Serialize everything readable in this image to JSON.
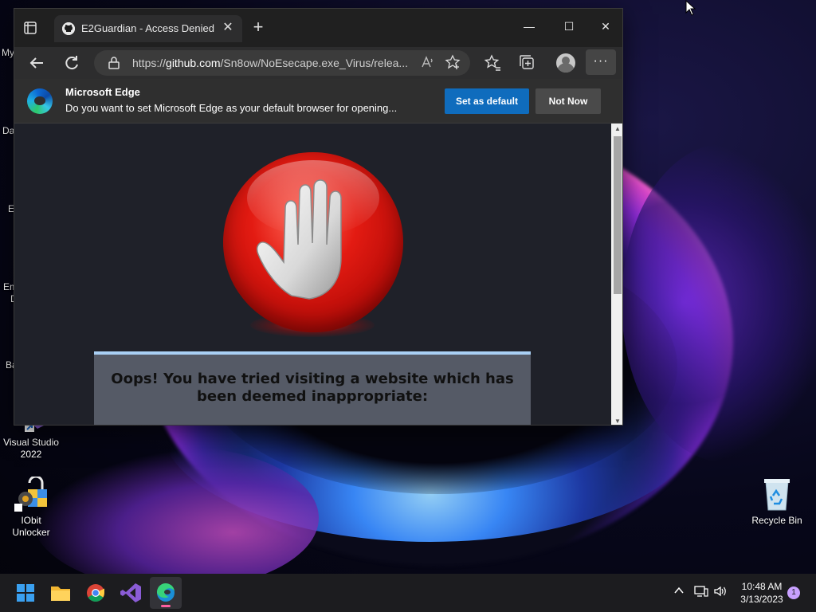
{
  "desktop": {
    "icons": [
      {
        "label_line1": "Visual Studio",
        "label_line2": "2022"
      },
      {
        "label_line1": "IObit",
        "label_line2": "Unlocker"
      },
      {
        "label_line1": "Recycle Bin",
        "label_line2": ""
      }
    ],
    "cut_labels": [
      "My",
      "Da",
      "E",
      "Em",
      "D",
      "Ba"
    ]
  },
  "browser": {
    "tab_title": "E2Guardian - Access Denied",
    "tab_close": "✕",
    "new_tab": "+",
    "window_controls": {
      "minimize": "—",
      "maximize": "☐",
      "close": "✕"
    },
    "address": {
      "url_prefix": "https://",
      "url_host": "github.com",
      "url_rest": "/Sn8ow/NoEsecape.exe_Virus/relea..."
    },
    "toolbar_icons": [
      "back-icon",
      "refresh-icon",
      "lock-icon",
      "read-aloud-icon",
      "add-favorite-icon",
      "favorites-icon",
      "collections-icon",
      "profile-icon",
      "more-icon"
    ],
    "more_label": "···",
    "infobar": {
      "title": "Microsoft Edge",
      "text": "Do you want to set Microsoft Edge as your default browser for opening...",
      "primary_button": "Set as default",
      "secondary_button": "Not Now"
    },
    "page": {
      "message": "Oops! You have tried visiting a website which has been deemed inappropriate:"
    }
  },
  "taskbar": {
    "apps": [
      "start-icon",
      "file-explorer-icon",
      "chrome-icon",
      "visual-studio-icon",
      "edge-icon"
    ],
    "time": "10:48 AM",
    "date": "3/13/2023",
    "notification_count": "1"
  },
  "colors": {
    "accent_blue": "#0f6cbd",
    "stop_red": "#e31b12",
    "panel_border": "#a9d0f5"
  }
}
